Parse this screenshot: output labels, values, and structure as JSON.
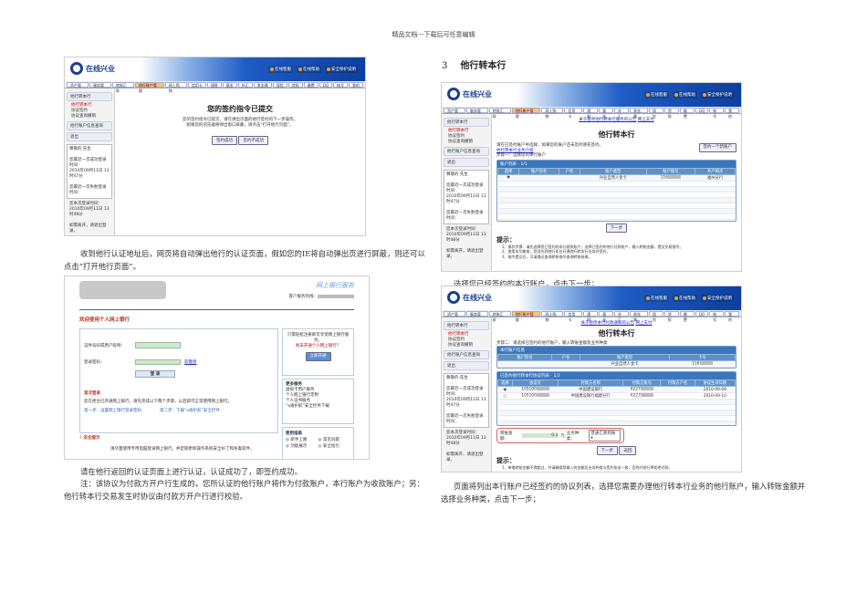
{
  "header": "精品文档---下载后可任意编辑",
  "section": {
    "number": "3",
    "title": "他行转本行"
  },
  "paragraphs": {
    "p1": "收到他行认证地址后，网页将自动弹出他行的认证页面，假如您的IE将自动弹出页进行屏蔽，则还可以点击“打开他行页面”。",
    "p2a": "请在他行返回的认证页面上进行认证，认证成功了，即签约成功。",
    "p2b": "注：该协议为付款方开户行生成的，您所认证的他行账户将作为付款账户，本行账户为收款账户；另：他行转本行交易发生时协议由付款方开户行进行校验。",
    "p3": "选择您已经签约的本行账户，点击下一步；",
    "p4": "页面将列出本行账户已经签约的协议列表，选择您需要办理他行转本行业务的他行账户，输入转账金额并选择业务种类，点击下一步；"
  },
  "bank": {
    "logo": "在线兴业",
    "header_links": [
      "在线客服",
      "在线帮助",
      "安全保护说明"
    ],
    "tabs": [
      "资产管理",
      "服务管理",
      "转账汇款",
      "他行账户管理",
      "网上购物",
      "信用卡",
      "理财",
      "基金",
      "外汇",
      "贵金属",
      "保险",
      "贷款",
      "缴费",
      "QQ",
      "帐号",
      "我的"
    ],
    "active_tab": 3,
    "sidebar": {
      "group1": "他行转本行",
      "items": [
        "他行转本行",
        "协议签约",
        "协议查询撤销"
      ],
      "group2": "他行账户信息查询",
      "group3": "退出",
      "greeting": "尊敬的       先生",
      "last_ok": "您最近一次成功登录时间：",
      "last_ok_time": "2010年09月11日 13时47分",
      "last_fail": "您最近一次失败登录时间：",
      "this_time": "您本次登录时间：",
      "this_time_val": "2010年09月11日 13时48分",
      "logout_hint": "如需离开，请退出登录。"
    }
  },
  "shot1": {
    "title": "您的签约指令已提交",
    "msg1": "您的签约指令已提交，请在弹出页面的他行签约的下一步操作。",
    "msg2": "如果您的浏览器将弹出窗口屏蔽，请点击“打开他行页面”。",
    "btn_ok": "签约成功",
    "btn_fail": "签约不成功"
  },
  "shot2": {
    "service": "网上银行服务",
    "hotline": "客户服务热线：",
    "welcome": "欢迎使用个人网上银行",
    "id_label": "证件号码或用户昵称：",
    "pwd_label": "登录密码：",
    "soft_kb": "软键盘",
    "login": "登 录",
    "first_login": "首次登录",
    "first_desc": "您在柜台已开通网上银行，请先完成以下两个步骤，以后即可正常使用网上银行。",
    "step1": "第一步：设置网上银行登录密码",
    "step2": "第二步：下载“e盾护航”安全控件",
    "security": "！安全提示",
    "sec_desc": "请尽量使用专用电脑登录网上银行，并定期更新操作系统安全补丁和杀毒软件。",
    "more": "更多服务",
    "more_items": [
      "虚拟卡用户服务",
      "个人网上银行定制",
      "个人证书服务",
      "“e盾护航”安全控件下载"
    ],
    "guide": "使用指南",
    "guide_items": [
      "新手上路",
      "常见问题",
      "功能展示",
      "安全指引"
    ],
    "side_text": "只需轻松注册即可享受网上银行服务。",
    "side_link": "尚未开通个人网上银行？",
    "open_btn": "立即开通"
  },
  "shot3": {
    "notice": "关于暂停他行转本行服务的公告",
    "notice2": "网上支付",
    "title": "他行转本行",
    "desc": "请在已签约账户中选择，如果您的账户还未签约请先签约。",
    "link": "他行转本行业务介绍",
    "step": "步骤一：选择您的本行账户",
    "add_btn": "签约一个新账户",
    "caption": "账户列表 - 1/1",
    "columns": [
      "选择",
      "账户别名",
      "户名",
      "账户类型",
      "账户账号",
      "开户网点"
    ],
    "rows": [
      [
        "◉",
        "",
        "",
        "兴业自然人金卡",
        "116",
        "福州分行"
      ]
    ],
    "next": "下一步",
    "tips_title": "提示：",
    "tips": [
      "1、操作步骤：请先选择您已签约的本行收款账户，选择已签约的他行付款账户，输入转账金额，提交交易指令。",
      "2、使用本功能前，您须先到他行柜台开通他行转本行业务并签约。",
      "3、指令提交后，可请通过查询转账指令查询转账结果。"
    ]
  },
  "shot4": {
    "notice": "关于暂停本行付款通知的公告",
    "notice2": "网上支付",
    "title": "他行转本行",
    "step": "步骤二：请选择已签约的他行账户，输入转账金额及业务种类",
    "acct_caption": "本行账户信息",
    "acct_columns": [
      "账户别名",
      "户名",
      "账户类型",
      "卡号"
    ],
    "acct_row": [
      "",
      "",
      "兴业自然人金卡",
      "116"
    ],
    "caption": "已签约他行转本行协议列表 - 1/2",
    "columns": [
      "选择",
      "协议号",
      "付款方名称",
      "付款方账号",
      "付款方户名",
      "协议生效日期"
    ],
    "rows": [
      [
        "◉",
        "105100",
        "中国建设银行",
        "6227",
        "",
        "2010-09-09"
      ],
      [
        "○",
        "105100",
        "中国建设银行福建分行",
        "6227",
        "",
        "2010-09-10"
      ]
    ],
    "amount_label": "转账金额：",
    "amount_value": "0.1",
    "unit": "元",
    "type_label": "业务种类：",
    "type_value": "普通汇款到账",
    "next": "下一步",
    "back": "返回",
    "tips_title": "提示：",
    "tips": [
      "1、单笔转账金额不得超过，并请确保您输入的金额及业务种类与签约协议一致，否则付款行将拒绝付款。"
    ]
  }
}
